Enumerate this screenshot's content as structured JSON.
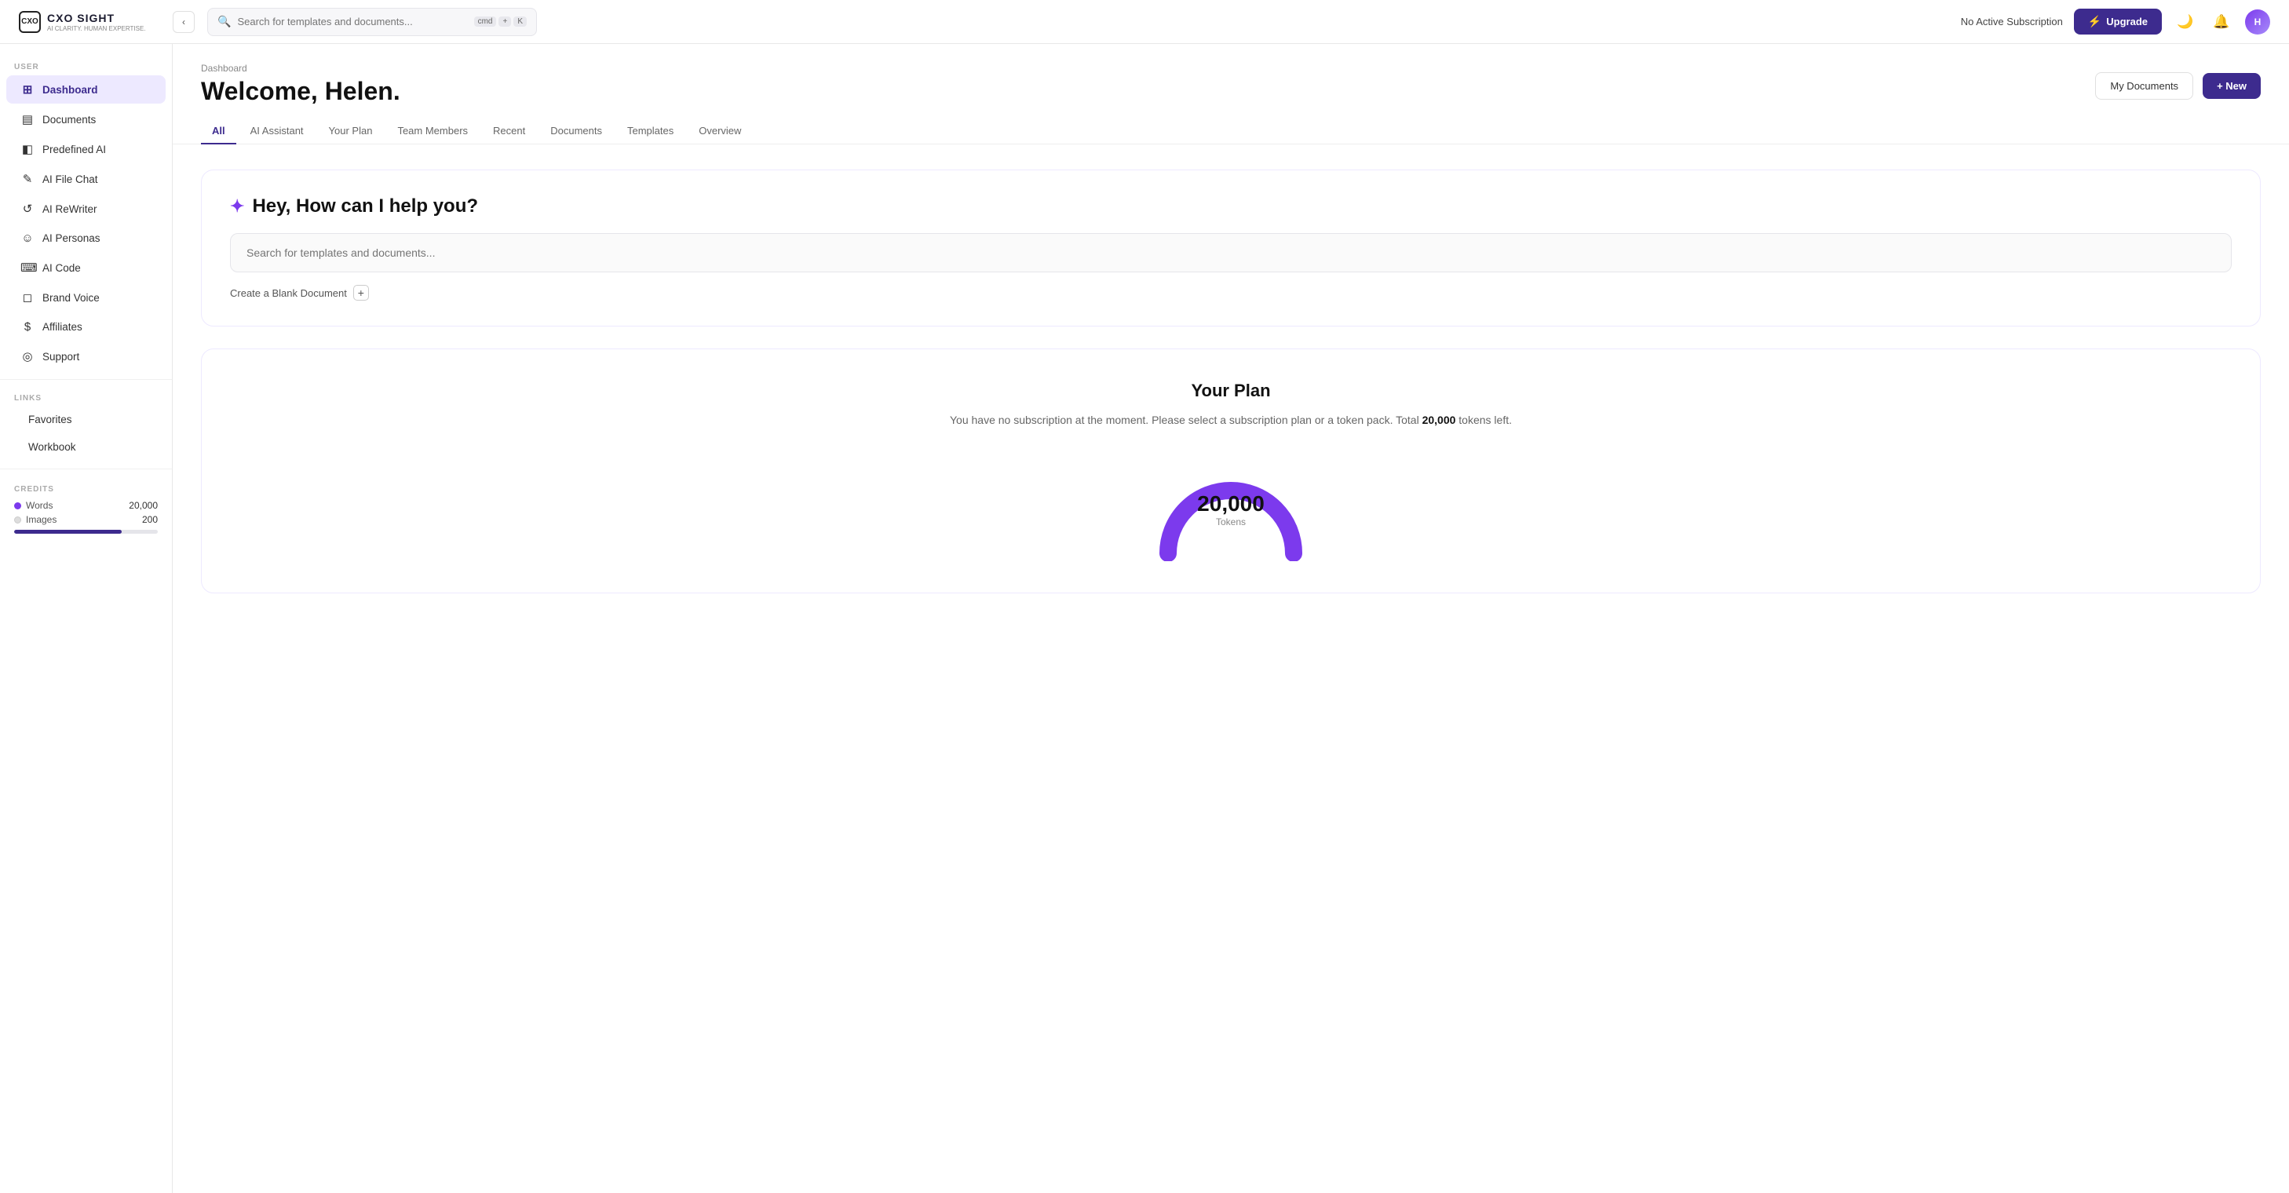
{
  "app": {
    "logo_text": "CXO SIGHT",
    "logo_sub": "AI CLARITY. HUMAN EXPERTISE."
  },
  "topnav": {
    "search_placeholder": "Search for templates and documents...",
    "kbd1": "cmd",
    "kbd_plus": "+",
    "kbd2": "K",
    "no_sub_label": "No Active Subscription",
    "upgrade_label": "Upgrade"
  },
  "sidebar": {
    "user_section": "USER",
    "items": [
      {
        "id": "dashboard",
        "label": "Dashboard",
        "icon": "⊞",
        "active": true
      },
      {
        "id": "documents",
        "label": "Documents",
        "icon": "▤"
      },
      {
        "id": "predefined-ai",
        "label": "Predefined AI",
        "icon": "◧"
      },
      {
        "id": "ai-file-chat",
        "label": "AI File Chat",
        "icon": "✎"
      },
      {
        "id": "ai-rewriter",
        "label": "AI ReWriter",
        "icon": "↺"
      },
      {
        "id": "ai-personas",
        "label": "AI Personas",
        "icon": "☺"
      },
      {
        "id": "ai-code",
        "label": "AI Code",
        "icon": "⌨"
      },
      {
        "id": "brand-voice",
        "label": "Brand Voice",
        "icon": "◻"
      },
      {
        "id": "affiliates",
        "label": "Affiliates",
        "icon": "$"
      },
      {
        "id": "support",
        "label": "Support",
        "icon": "◎"
      }
    ],
    "links_section": "LINKS",
    "links": [
      {
        "id": "favorites",
        "label": "Favorites"
      },
      {
        "id": "workbook",
        "label": "Workbook"
      }
    ],
    "credits_section": "CREDITS",
    "words_label": "Words",
    "words_value": "20,000",
    "images_label": "Images",
    "images_value": "200",
    "progress_percent": 75
  },
  "page": {
    "breadcrumb": "Dashboard",
    "title": "Welcome, Helen.",
    "my_docs_label": "My Documents",
    "new_label": "+ New"
  },
  "tabs": [
    {
      "id": "all",
      "label": "All",
      "active": true
    },
    {
      "id": "ai-assistant",
      "label": "AI Assistant"
    },
    {
      "id": "your-plan",
      "label": "Your Plan"
    },
    {
      "id": "team-members",
      "label": "Team Members"
    },
    {
      "id": "recent",
      "label": "Recent"
    },
    {
      "id": "documents",
      "label": "Documents"
    },
    {
      "id": "templates",
      "label": "Templates"
    },
    {
      "id": "overview",
      "label": "Overview"
    }
  ],
  "ai_help": {
    "title": "Hey, How can I help you?",
    "search_placeholder": "Search for templates and documents...",
    "create_blank_label": "Create a Blank Document"
  },
  "plan": {
    "title": "Your Plan",
    "desc_prefix": "You have no subscription at the moment. Please select a subscription plan or a token pack. Total ",
    "tokens_bold": "20,000",
    "desc_suffix": " tokens left.",
    "gauge_number": "20,000",
    "gauge_label": "Tokens"
  }
}
